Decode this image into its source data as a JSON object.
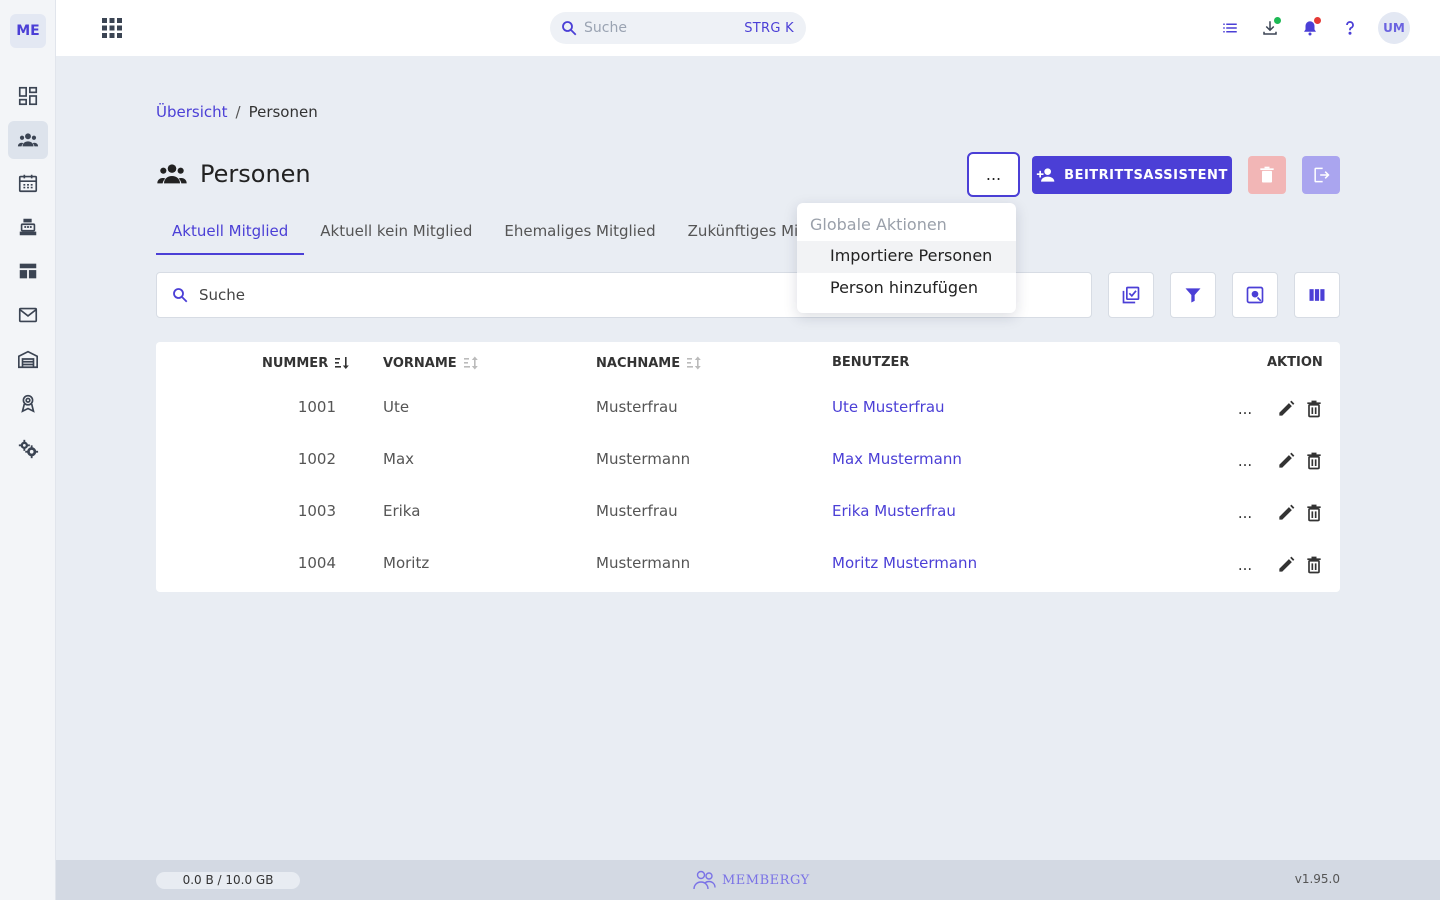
{
  "app": {
    "logo_text": "ME"
  },
  "topbar": {
    "search_placeholder": "Suche",
    "search_shortcut": "STRG K",
    "avatar_initials": "UM",
    "icons": [
      "apps-icon",
      "task-list-icon",
      "download-icon",
      "notification-bell-icon",
      "help-icon"
    ],
    "badge_colors": {
      "download": "#1db954",
      "notifications": "#e53935"
    }
  },
  "sidebar": {
    "items": [
      {
        "name": "dashboard",
        "icon": "dashboard-icon",
        "active": false
      },
      {
        "name": "persons",
        "icon": "people-icon",
        "active": true
      },
      {
        "name": "calendar",
        "icon": "calendar-icon",
        "active": false
      },
      {
        "name": "cashbox",
        "icon": "cash-register-icon",
        "active": false
      },
      {
        "name": "table",
        "icon": "table-icon",
        "active": false
      },
      {
        "name": "mail",
        "icon": "mail-icon",
        "active": false
      },
      {
        "name": "warehouse",
        "icon": "warehouse-icon",
        "active": false
      },
      {
        "name": "awards",
        "icon": "medal-icon",
        "active": false
      },
      {
        "name": "settings",
        "icon": "gears-icon",
        "active": false
      }
    ]
  },
  "breadcrumb": {
    "home": "Übersicht",
    "separator": "/",
    "current": "Personen"
  },
  "page": {
    "title": "Personen",
    "more_label": "...",
    "wizard_label": "BEITRITTSASSISTENT"
  },
  "tabs": [
    {
      "label": "Aktuell Mitglied",
      "active": true
    },
    {
      "label": "Aktuell kein Mitglied",
      "active": false
    },
    {
      "label": "Ehemaliges Mitglied",
      "active": false
    },
    {
      "label": "Zukünftiges Mitglied",
      "active": false
    }
  ],
  "search": {
    "placeholder": "Suche"
  },
  "dropdown": {
    "header": "Globale Aktionen",
    "items": [
      "Importiere Personen",
      "Person hinzufügen"
    ]
  },
  "table": {
    "columns": {
      "number": "NUMMER",
      "firstname": "VORNAME",
      "lastname": "NACHNAME",
      "user": "BENUTZER",
      "action": "AKTION"
    },
    "action_more": "...",
    "rows": [
      {
        "number": "1001",
        "firstname": "Ute",
        "lastname": "Musterfrau",
        "user": "Ute Musterfrau"
      },
      {
        "number": "1002",
        "firstname": "Max",
        "lastname": "Mustermann",
        "user": "Max Mustermann"
      },
      {
        "number": "1003",
        "firstname": "Erika",
        "lastname": "Musterfrau",
        "user": "Erika Musterfrau"
      },
      {
        "number": "1004",
        "firstname": "Moritz",
        "lastname": "Mustermann",
        "user": "Moritz Mustermann"
      }
    ]
  },
  "footer": {
    "storage": "0.0 B / 10.0 GB",
    "brand": "MEMBERGY",
    "version": "v1.95.0"
  },
  "colors": {
    "accent": "#4b3fd6",
    "danger_disabled": "#f2b6b6",
    "accent_disabled": "#aaa5ef"
  }
}
